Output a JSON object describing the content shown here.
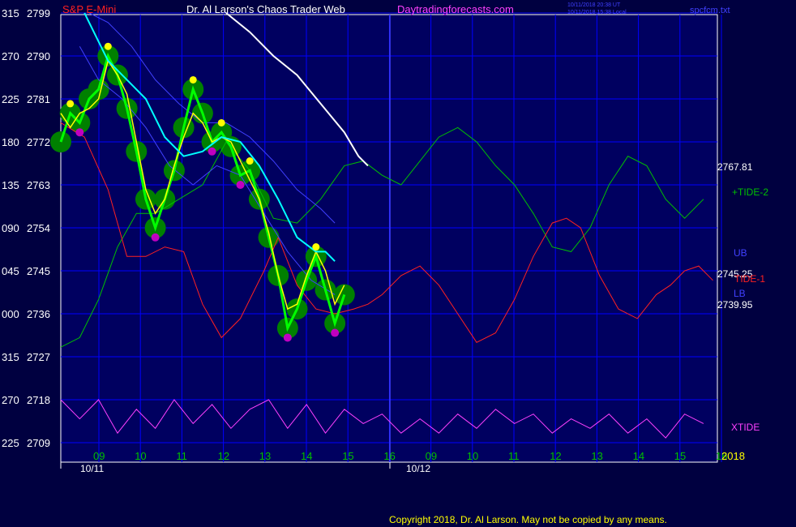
{
  "header": {
    "symbol": "S&P E-Mini",
    "title": "Dr. Al Larson's Chaos Trader Web",
    "site": "Daytradingforecasts.com",
    "timestamp1": "10/11/2018 20:38 UT",
    "timestamp2": "10/11/2018 15:38 Local",
    "file": "spcfcm.txt"
  },
  "footer": {
    "copyright": "Copyright 2018, Dr. Al Larson. May not be copied by any means."
  },
  "colors": {
    "background": "#000040",
    "plot_bg": "#000060",
    "grid": "#0000ff",
    "axis_text": "#ffffff",
    "price_line": "#00ff00",
    "price_bubble": "#008000",
    "ma_fast": "#ffff00",
    "ma_slow": "#00ffff",
    "band": "#4040ff",
    "white_line": "#ffffff",
    "tide1": "#ff2020",
    "tide2": "#00c000",
    "xtide": "#ff40ff",
    "highs": "#ffff00",
    "lows": "#c000c0",
    "time_label": "#00c000"
  },
  "chart_data": {
    "type": "line",
    "y_axis": {
      "left_labels": [
        "315",
        "270",
        "225",
        "180",
        "135",
        "090",
        "045",
        "000",
        "315",
        "270",
        "225"
      ],
      "price_labels": [
        "2799",
        "2790",
        "2781",
        "2772",
        "2763",
        "2754",
        "2745",
        "2736",
        "2727",
        "2718",
        "2709"
      ],
      "ylim": [
        2709,
        2799
      ]
    },
    "x_axis": {
      "hour_labels": [
        "09",
        "10",
        "11",
        "12",
        "13",
        "14",
        "15",
        "16",
        "09",
        "10",
        "11",
        "12",
        "13",
        "14",
        "15",
        "16"
      ],
      "date_labels": [
        "10/11",
        "10/12"
      ],
      "year_label": "2018"
    },
    "price_readouts": [
      "2767.81",
      "2745.25",
      "2739.95"
    ],
    "series_labels": [
      "+TIDE-2",
      "UB",
      "TIDE-1",
      "LB",
      "XTIDE"
    ],
    "price_path": [
      [
        0.0,
        2772
      ],
      [
        0.2,
        2778
      ],
      [
        0.4,
        2776
      ],
      [
        0.6,
        2781
      ],
      [
        0.8,
        2783
      ],
      [
        1.0,
        2790
      ],
      [
        1.2,
        2786
      ],
      [
        1.4,
        2779
      ],
      [
        1.6,
        2770
      ],
      [
        1.8,
        2760
      ],
      [
        2.0,
        2754
      ],
      [
        2.2,
        2760
      ],
      [
        2.4,
        2766
      ],
      [
        2.6,
        2775
      ],
      [
        2.8,
        2783
      ],
      [
        3.0,
        2778
      ],
      [
        3.2,
        2772
      ],
      [
        3.4,
        2774
      ],
      [
        3.6,
        2771
      ],
      [
        3.8,
        2765
      ],
      [
        4.0,
        2766
      ],
      [
        4.2,
        2760
      ],
      [
        4.4,
        2752
      ],
      [
        4.6,
        2744
      ],
      [
        4.8,
        2733
      ],
      [
        5.0,
        2737
      ],
      [
        5.2,
        2743
      ],
      [
        5.4,
        2748
      ],
      [
        5.6,
        2741
      ],
      [
        5.8,
        2734
      ],
      [
        6.0,
        2740
      ]
    ],
    "fast_avg": [
      [
        0.0,
        2778
      ],
      [
        0.2,
        2775
      ],
      [
        0.4,
        2778
      ],
      [
        0.6,
        2779
      ],
      [
        0.8,
        2781
      ],
      [
        1.0,
        2789
      ],
      [
        1.2,
        2786
      ],
      [
        1.4,
        2782
      ],
      [
        1.6,
        2772
      ],
      [
        1.8,
        2762
      ],
      [
        2.0,
        2757
      ],
      [
        2.2,
        2760
      ],
      [
        2.4,
        2767
      ],
      [
        2.6,
        2773
      ],
      [
        2.8,
        2778
      ],
      [
        3.0,
        2776
      ],
      [
        3.2,
        2772
      ],
      [
        3.4,
        2773
      ],
      [
        3.6,
        2772
      ],
      [
        3.8,
        2768
      ],
      [
        4.0,
        2764
      ],
      [
        4.2,
        2760
      ],
      [
        4.4,
        2753
      ],
      [
        4.6,
        2744
      ],
      [
        4.8,
        2737
      ],
      [
        5.0,
        2738
      ],
      [
        5.2,
        2744
      ],
      [
        5.4,
        2749
      ],
      [
        5.6,
        2745
      ],
      [
        5.8,
        2738
      ],
      [
        6.0,
        2742
      ]
    ],
    "slow_avg": [
      [
        0.5,
        2799
      ],
      [
        0.8,
        2793
      ],
      [
        1.0,
        2789
      ],
      [
        1.4,
        2785
      ],
      [
        1.8,
        2781
      ],
      [
        2.2,
        2773
      ],
      [
        2.6,
        2769
      ],
      [
        3.0,
        2770
      ],
      [
        3.4,
        2773
      ],
      [
        3.8,
        2772
      ],
      [
        4.2,
        2767
      ],
      [
        4.6,
        2760
      ],
      [
        5.0,
        2752
      ],
      [
        5.4,
        2749
      ],
      [
        5.6,
        2749
      ],
      [
        5.8,
        2747
      ]
    ],
    "upper_band": [
      [
        0.6,
        2799
      ],
      [
        1.0,
        2797
      ],
      [
        1.5,
        2792
      ],
      [
        2.0,
        2785
      ],
      [
        2.5,
        2780
      ],
      [
        3.0,
        2776
      ],
      [
        3.5,
        2776
      ],
      [
        4.0,
        2773
      ],
      [
        4.5,
        2768
      ],
      [
        5.0,
        2762
      ],
      [
        5.5,
        2758
      ],
      [
        5.8,
        2755
      ]
    ],
    "lower_band": [
      [
        0.4,
        2792
      ],
      [
        0.8,
        2785
      ],
      [
        1.3,
        2781
      ],
      [
        1.8,
        2775
      ],
      [
        2.3,
        2767
      ],
      [
        2.8,
        2763
      ],
      [
        3.3,
        2767
      ],
      [
        3.8,
        2765
      ],
      [
        4.3,
        2757
      ],
      [
        4.8,
        2749
      ],
      [
        5.3,
        2743
      ],
      [
        5.8,
        2740
      ]
    ],
    "white_line": [
      [
        3.5,
        2799
      ],
      [
        4.0,
        2795
      ],
      [
        4.5,
        2790
      ],
      [
        5.0,
        2786
      ],
      [
        5.5,
        2780
      ],
      [
        6.0,
        2774
      ],
      [
        6.3,
        2769
      ],
      [
        6.5,
        2767
      ]
    ],
    "tide1": [
      [
        0.0,
        2776
      ],
      [
        0.5,
        2773
      ],
      [
        1.0,
        2762
      ],
      [
        1.4,
        2748
      ],
      [
        1.8,
        2748
      ],
      [
        2.2,
        2750
      ],
      [
        2.6,
        2749
      ],
      [
        3.0,
        2738
      ],
      [
        3.4,
        2731
      ],
      [
        3.8,
        2735
      ],
      [
        4.3,
        2745
      ],
      [
        4.6,
        2752
      ],
      [
        5.0,
        2742
      ],
      [
        5.4,
        2737
      ],
      [
        5.8,
        2736
      ],
      [
        6.2,
        2737
      ],
      [
        6.5,
        2738
      ],
      [
        6.8,
        2740
      ],
      [
        7.2,
        2744
      ],
      [
        7.6,
        2746
      ],
      [
        8.0,
        2742
      ],
      [
        8.4,
        2736
      ],
      [
        8.8,
        2730
      ],
      [
        9.2,
        2732
      ],
      [
        9.6,
        2739
      ],
      [
        10.0,
        2748
      ],
      [
        10.4,
        2755
      ],
      [
        10.7,
        2756
      ],
      [
        11.0,
        2754
      ],
      [
        11.4,
        2744
      ],
      [
        11.8,
        2737
      ],
      [
        12.2,
        2735
      ],
      [
        12.6,
        2740
      ],
      [
        12.9,
        2742
      ],
      [
        13.2,
        2745
      ],
      [
        13.5,
        2746
      ],
      [
        13.8,
        2743
      ]
    ],
    "tide2": [
      [
        0.0,
        2729
      ],
      [
        0.4,
        2731
      ],
      [
        0.8,
        2739
      ],
      [
        1.2,
        2750
      ],
      [
        1.6,
        2757
      ],
      [
        2.0,
        2757
      ],
      [
        2.5,
        2760
      ],
      [
        3.0,
        2763
      ],
      [
        3.5,
        2772
      ],
      [
        4.0,
        2766
      ],
      [
        4.5,
        2756
      ],
      [
        5.0,
        2755
      ],
      [
        5.5,
        2760
      ],
      [
        6.0,
        2767
      ],
      [
        6.4,
        2768
      ],
      [
        6.8,
        2765
      ],
      [
        7.2,
        2763
      ],
      [
        7.6,
        2768
      ],
      [
        8.0,
        2773
      ],
      [
        8.4,
        2775
      ],
      [
        8.8,
        2772
      ],
      [
        9.2,
        2767
      ],
      [
        9.6,
        2763
      ],
      [
        10.0,
        2757
      ],
      [
        10.4,
        2750
      ],
      [
        10.8,
        2749
      ],
      [
        11.2,
        2754
      ],
      [
        11.6,
        2763
      ],
      [
        12.0,
        2769
      ],
      [
        12.4,
        2767
      ],
      [
        12.8,
        2760
      ],
      [
        13.2,
        2756
      ],
      [
        13.6,
        2760
      ]
    ],
    "xtide": [
      [
        0.0,
        2718
      ],
      [
        0.4,
        2714
      ],
      [
        0.8,
        2718
      ],
      [
        1.2,
        2711
      ],
      [
        1.6,
        2716
      ],
      [
        2.0,
        2712
      ],
      [
        2.4,
        2718
      ],
      [
        2.8,
        2713
      ],
      [
        3.2,
        2717
      ],
      [
        3.6,
        2712
      ],
      [
        4.0,
        2716
      ],
      [
        4.4,
        2718
      ],
      [
        4.8,
        2712
      ],
      [
        5.2,
        2717
      ],
      [
        5.6,
        2711
      ],
      [
        6.0,
        2716
      ],
      [
        6.4,
        2713
      ],
      [
        6.8,
        2715
      ],
      [
        7.2,
        2711
      ],
      [
        7.6,
        2714
      ],
      [
        8.0,
        2711
      ],
      [
        8.4,
        2715
      ],
      [
        8.8,
        2712
      ],
      [
        9.2,
        2716
      ],
      [
        9.6,
        2713
      ],
      [
        10.0,
        2715
      ],
      [
        10.4,
        2711
      ],
      [
        10.8,
        2714
      ],
      [
        11.2,
        2712
      ],
      [
        11.6,
        2715
      ],
      [
        12.0,
        2711
      ],
      [
        12.4,
        2714
      ],
      [
        12.8,
        2710
      ],
      [
        13.2,
        2715
      ],
      [
        13.6,
        2713
      ]
    ]
  }
}
